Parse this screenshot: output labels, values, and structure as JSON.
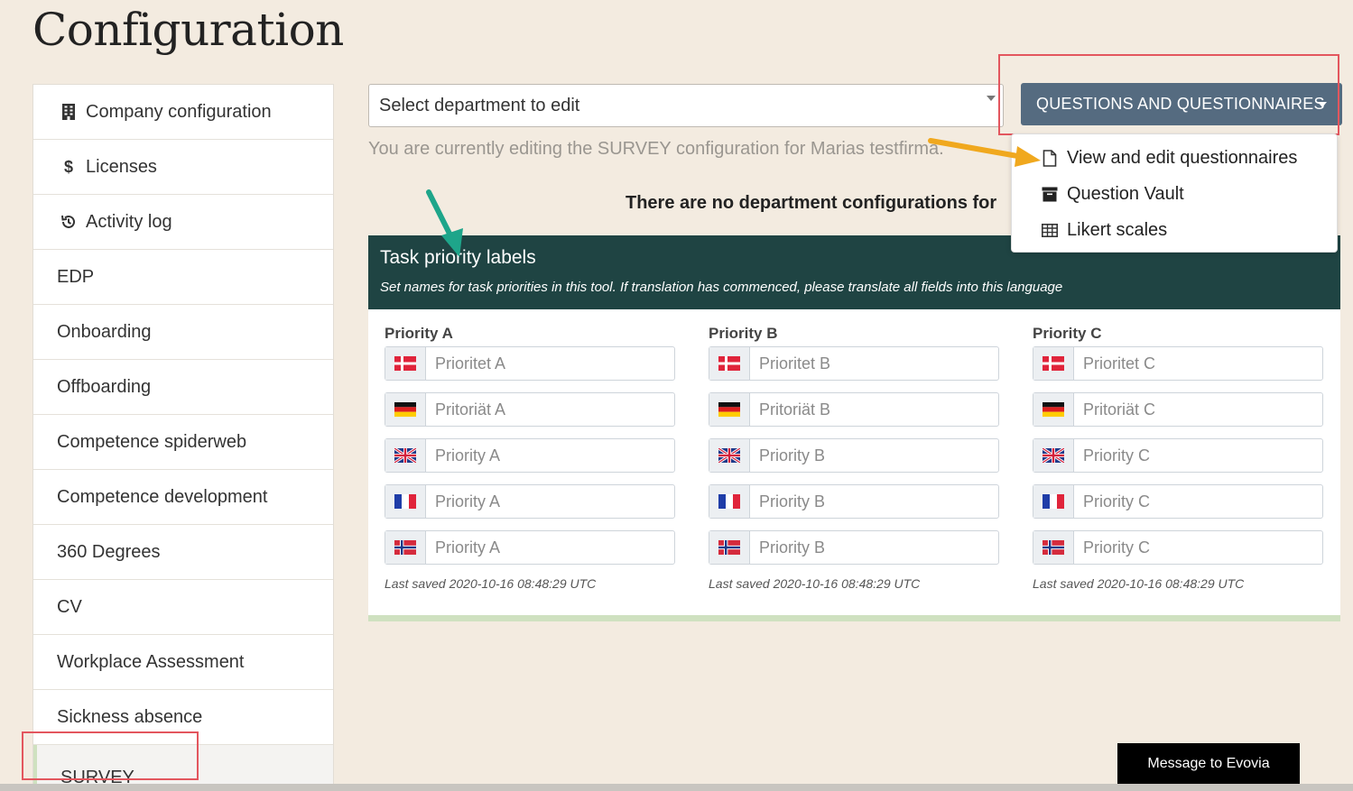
{
  "page": {
    "title": "Configuration"
  },
  "sidebar": {
    "items": [
      {
        "label": "Company configuration",
        "icon": "building-icon"
      },
      {
        "label": "Licenses",
        "icon": "dollar-icon"
      },
      {
        "label": "Activity log",
        "icon": "history-icon"
      },
      {
        "label": "EDP"
      },
      {
        "label": "Onboarding"
      },
      {
        "label": "Offboarding"
      },
      {
        "label": "Competence spiderweb"
      },
      {
        "label": "Competence development"
      },
      {
        "label": "360 Degrees"
      },
      {
        "label": "CV"
      },
      {
        "label": "Workplace Assessment"
      },
      {
        "label": "Sickness absence"
      },
      {
        "label": "SURVEY",
        "active": true
      }
    ]
  },
  "department": {
    "select_label": "Select department to edit",
    "editing_note": "You are currently editing the SURVEY configuration for Marias testfirma.",
    "no_config_message": "There are no department configurations for"
  },
  "questions_menu": {
    "button_label": "QUESTIONS AND QUESTIONNAIRES",
    "items": [
      {
        "label": "View and edit questionnaires",
        "icon": "file-icon"
      },
      {
        "label": "Question Vault",
        "icon": "archive-icon"
      },
      {
        "label": "Likert scales",
        "icon": "table-icon"
      }
    ]
  },
  "priority_card": {
    "title": "Task priority labels",
    "subtitle": "Set names for task priorities in this tool. If translation has commenced, please translate all fields into this language",
    "columns": [
      {
        "label": "Priority A",
        "values": [
          "Prioritet A",
          "Pritoriät A",
          "Priority A",
          "Priority A",
          "Priority A"
        ],
        "last_saved": "Last saved 2020-10-16 08:48:29 UTC"
      },
      {
        "label": "Priority B",
        "values": [
          "Prioritet B",
          "Pritoriät B",
          "Priority B",
          "Priority B",
          "Priority B"
        ],
        "last_saved": "Last saved 2020-10-16 08:48:29 UTC"
      },
      {
        "label": "Priority C",
        "values": [
          "Prioritet C",
          "Pritoriät C",
          "Priority C",
          "Priority C",
          "Priority C"
        ],
        "last_saved": "Last saved 2020-10-16 08:48:29 UTC"
      }
    ],
    "flags": [
      "danish-flag-icon",
      "german-flag-icon",
      "uk-flag-icon",
      "french-flag-icon",
      "norwegian-flag-icon"
    ]
  },
  "message_button": {
    "label": "Message to Evovia"
  },
  "colors": {
    "background": "#f3ebe0",
    "button": "#556b80",
    "card_header": "#1f4443",
    "highlight_box": "#e3565e",
    "arrow_orange": "#f0a81e",
    "arrow_teal": "#1ea58a"
  }
}
